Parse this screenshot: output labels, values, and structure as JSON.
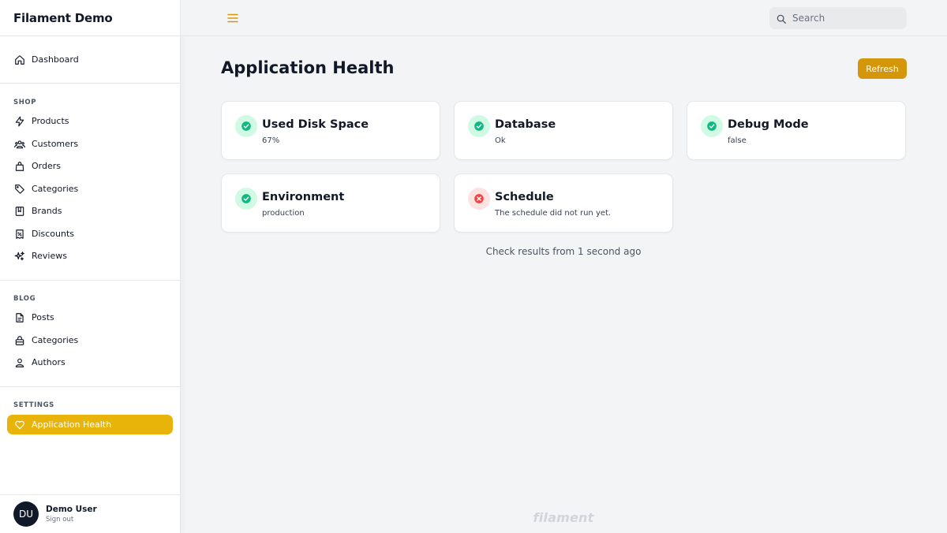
{
  "app": {
    "title": "Filament Demo"
  },
  "sidebar": {
    "dashboard": {
      "label": "Dashboard",
      "icon": "home-icon"
    },
    "sections": [
      {
        "label": "SHOP",
        "items": [
          {
            "label": "Products",
            "icon": "bolt-icon"
          },
          {
            "label": "Customers",
            "icon": "users-group-icon"
          },
          {
            "label": "Orders",
            "icon": "shopping-bag-icon"
          },
          {
            "label": "Categories",
            "icon": "tag-icon"
          },
          {
            "label": "Brands",
            "icon": "book-icon"
          },
          {
            "label": "Discounts",
            "icon": "receipt-icon"
          },
          {
            "label": "Reviews",
            "icon": "sparkles-icon"
          }
        ]
      },
      {
        "label": "BLOG",
        "items": [
          {
            "label": "Posts",
            "icon": "document-icon"
          },
          {
            "label": "Categories",
            "icon": "lock-bag-icon"
          },
          {
            "label": "Authors",
            "icon": "user-icon"
          }
        ]
      },
      {
        "label": "SETTINGS",
        "items": [
          {
            "label": "Application Health",
            "icon": "heart-icon",
            "active": true
          }
        ]
      }
    ],
    "user": {
      "initials": "DU",
      "name": "Demo User",
      "sign_out": "Sign out"
    }
  },
  "topbar": {
    "search_placeholder": "Search"
  },
  "main": {
    "title": "Application Health",
    "refresh_label": "Refresh",
    "checks": [
      {
        "title": "Used Disk Space",
        "value": "67%",
        "status": "ok"
      },
      {
        "title": "Database",
        "value": "Ok",
        "status": "ok"
      },
      {
        "title": "Debug Mode",
        "value": "false",
        "status": "ok"
      },
      {
        "title": "Environment",
        "value": "production",
        "status": "ok"
      },
      {
        "title": "Schedule",
        "value": "The schedule did not run yet.",
        "status": "failed"
      }
    ],
    "check_results_text": "Check results from 1 second ago"
  },
  "footer": {
    "logo_text": "filament"
  },
  "colors": {
    "accent": "#e8b40a",
    "button": "#d4960a",
    "ok": "#10b981",
    "fail": "#ef4444"
  }
}
